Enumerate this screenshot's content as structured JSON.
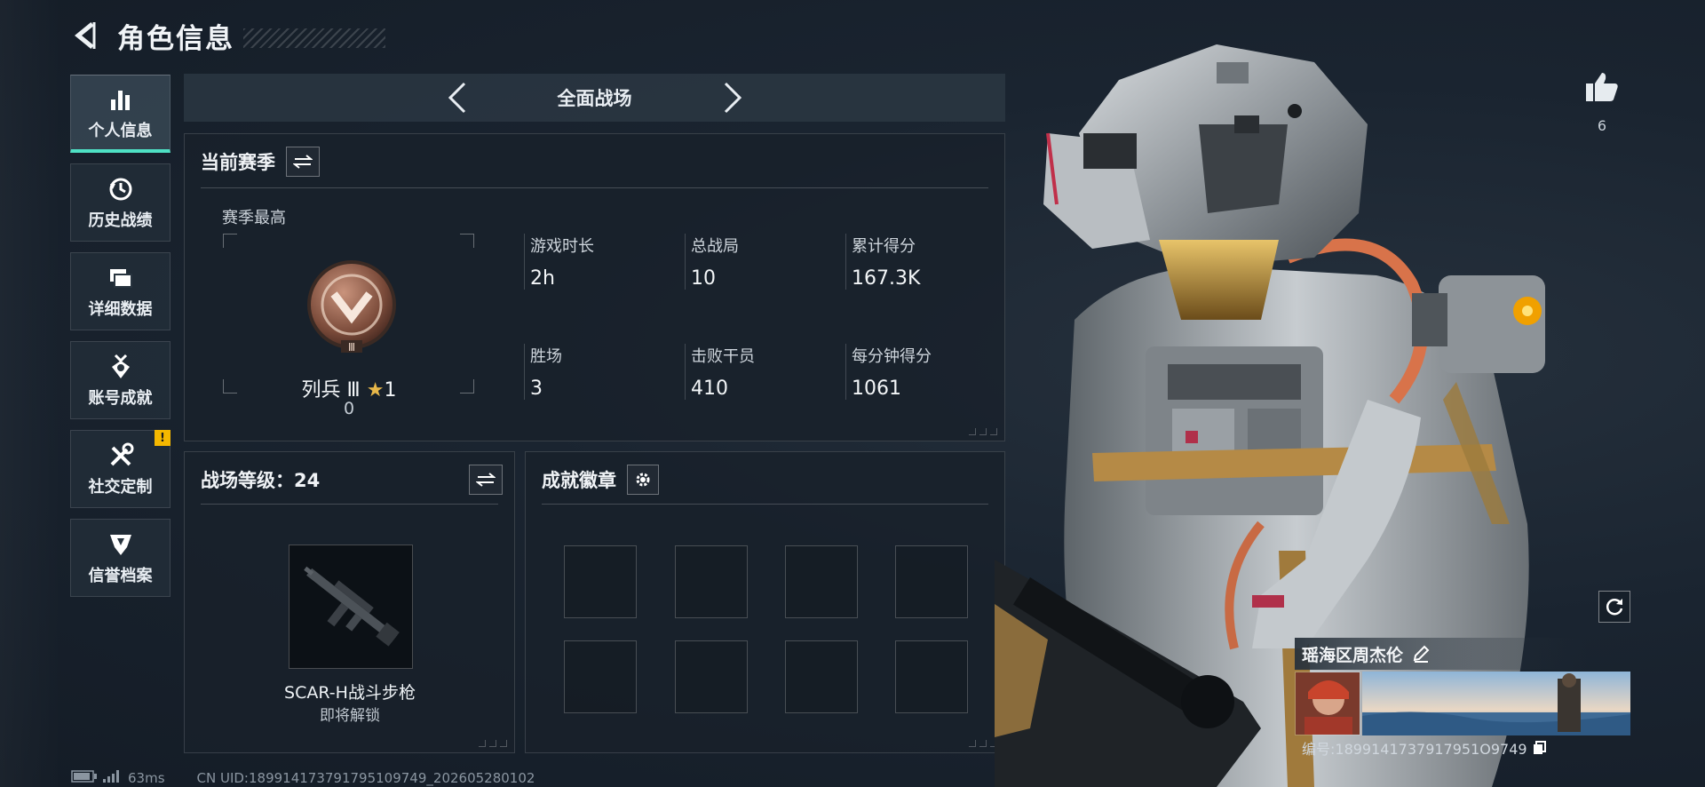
{
  "header": {
    "title": "角色信息"
  },
  "nav": {
    "items": [
      {
        "label": "个人信息",
        "icon": "bar-chart-icon",
        "active": true
      },
      {
        "label": "历史战绩",
        "icon": "history-clock-icon",
        "active": false
      },
      {
        "label": "详细数据",
        "icon": "folders-icon",
        "active": false
      },
      {
        "label": "账号成就",
        "icon": "medal-icon",
        "active": false
      },
      {
        "label": "社交定制",
        "icon": "tools-icon",
        "active": false,
        "badge": "!"
      },
      {
        "label": "信誉档案",
        "icon": "shield-wing-icon",
        "active": false
      }
    ]
  },
  "mode": {
    "title": "全面战场"
  },
  "season": {
    "title": "当前赛季",
    "best_label": "赛季最高",
    "rank_name": "列兵 Ⅲ",
    "rank_stars": "1",
    "rank_score": "0",
    "rank_emblem_numeral": "Ⅲ",
    "stats": [
      {
        "label": "游戏时长",
        "value": "2h"
      },
      {
        "label": "总战局",
        "value": "10"
      },
      {
        "label": "累计得分",
        "value": "167.3K"
      },
      {
        "label": "胜场",
        "value": "3"
      },
      {
        "label": "击败干员",
        "value": "410"
      },
      {
        "label": "每分钟得分",
        "value": "1061"
      }
    ]
  },
  "battle_level": {
    "title": "战场等级：24",
    "weapon_name": "SCAR-H战斗步枪",
    "weapon_status": "即将解锁"
  },
  "badges": {
    "title": "成就徽章",
    "slot_count": 8
  },
  "profile": {
    "likes": "6",
    "player_name": "瑶海区周杰伦",
    "player_id": "编号:1899141737917951O9749"
  },
  "footer": {
    "ping": "63ms",
    "uid": "CN UID:18991417379179510974​9_202605280102"
  },
  "colors": {
    "accent": "#4ee0c4",
    "badge": "#f5b800",
    "star": "#e8b84a",
    "rank_bronze": "#9a6a55"
  }
}
